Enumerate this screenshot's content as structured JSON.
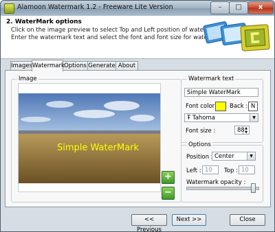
{
  "window": {
    "title": "Alamoon Watermark 1.2 - Freeware Lite Version",
    "min_glyph": "–",
    "max_glyph": "□",
    "close_glyph": "x"
  },
  "header": {
    "title": "2. WaterMark options",
    "description": "Click on the image preview to select Top and Left position of watermark. Enter the watermark text and select the font and font size for watermark."
  },
  "tabs": [
    {
      "label": "Images"
    },
    {
      "label": "Watermark"
    },
    {
      "label": "Options"
    },
    {
      "label": "Generate"
    },
    {
      "label": "About"
    }
  ],
  "image_group": {
    "label": "Image",
    "watermark_overlay": "Simple WaterMark",
    "zoom_in_glyph": "+",
    "zoom_out_glyph": "−"
  },
  "watermark_text": {
    "label": "Watermark text",
    "value": "Simple WaterMark",
    "font_color_label": "Font color :",
    "font_color": "#ffff00",
    "back_label": "Back :",
    "back_value": "N",
    "font_icon_glyph": "Ŧ",
    "font_name": "Tahoma",
    "font_size_label": "Font size :",
    "font_size": "88"
  },
  "options": {
    "label": "Options",
    "position_label": "Position :",
    "position_value": "Center",
    "left_label": "Left :",
    "left_value": "10",
    "top_label": "Top :",
    "top_value": "10",
    "opacity_label": "Watermark opacity :",
    "opacity": 0.95
  },
  "footer": {
    "previous": "<< Previous",
    "next": "Next >>",
    "close": "Close"
  }
}
